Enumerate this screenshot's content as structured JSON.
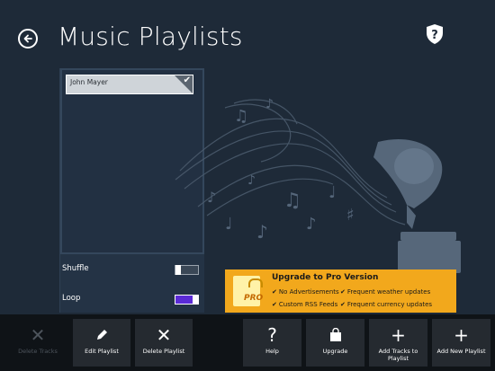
{
  "header": {
    "title": "Music Playlists",
    "back_icon": "back-arrow-icon",
    "help_icon": "shield-question-icon"
  },
  "playlists": {
    "items": [
      {
        "label": "John Mayer",
        "selected": true
      }
    ]
  },
  "toggles": {
    "shuffle": {
      "label": "Shuffle",
      "on": false
    },
    "loop": {
      "label": "Loop",
      "on": true
    }
  },
  "promo": {
    "badge": "PRO",
    "title": "Upgrade to Pro Version",
    "features": [
      "No Advertisements",
      "Frequent weather updates",
      "Custom RSS Feeds",
      "Frequent currency updates"
    ],
    "color": "#f2a81c"
  },
  "appbar": {
    "buttons": [
      {
        "label": "Delete Tracks",
        "icon": "close-icon",
        "enabled": false
      },
      {
        "label": "Edit Playlist",
        "icon": "pencil-icon",
        "enabled": true
      },
      {
        "label": "Delete Playlist",
        "icon": "close-icon",
        "enabled": true
      },
      {
        "label": "Help",
        "icon": "question-icon",
        "enabled": true
      },
      {
        "label": "Upgrade",
        "icon": "shopping-bag-icon",
        "enabled": true
      },
      {
        "label": "Add Tracks to Playlist",
        "icon": "plus-icon",
        "enabled": true
      },
      {
        "label": "Add New Playlist",
        "icon": "plus-icon",
        "enabled": true
      }
    ]
  },
  "colors": {
    "background": "#1e2a38",
    "accent": "#5b2bd6",
    "appbar": "#0f1317"
  }
}
